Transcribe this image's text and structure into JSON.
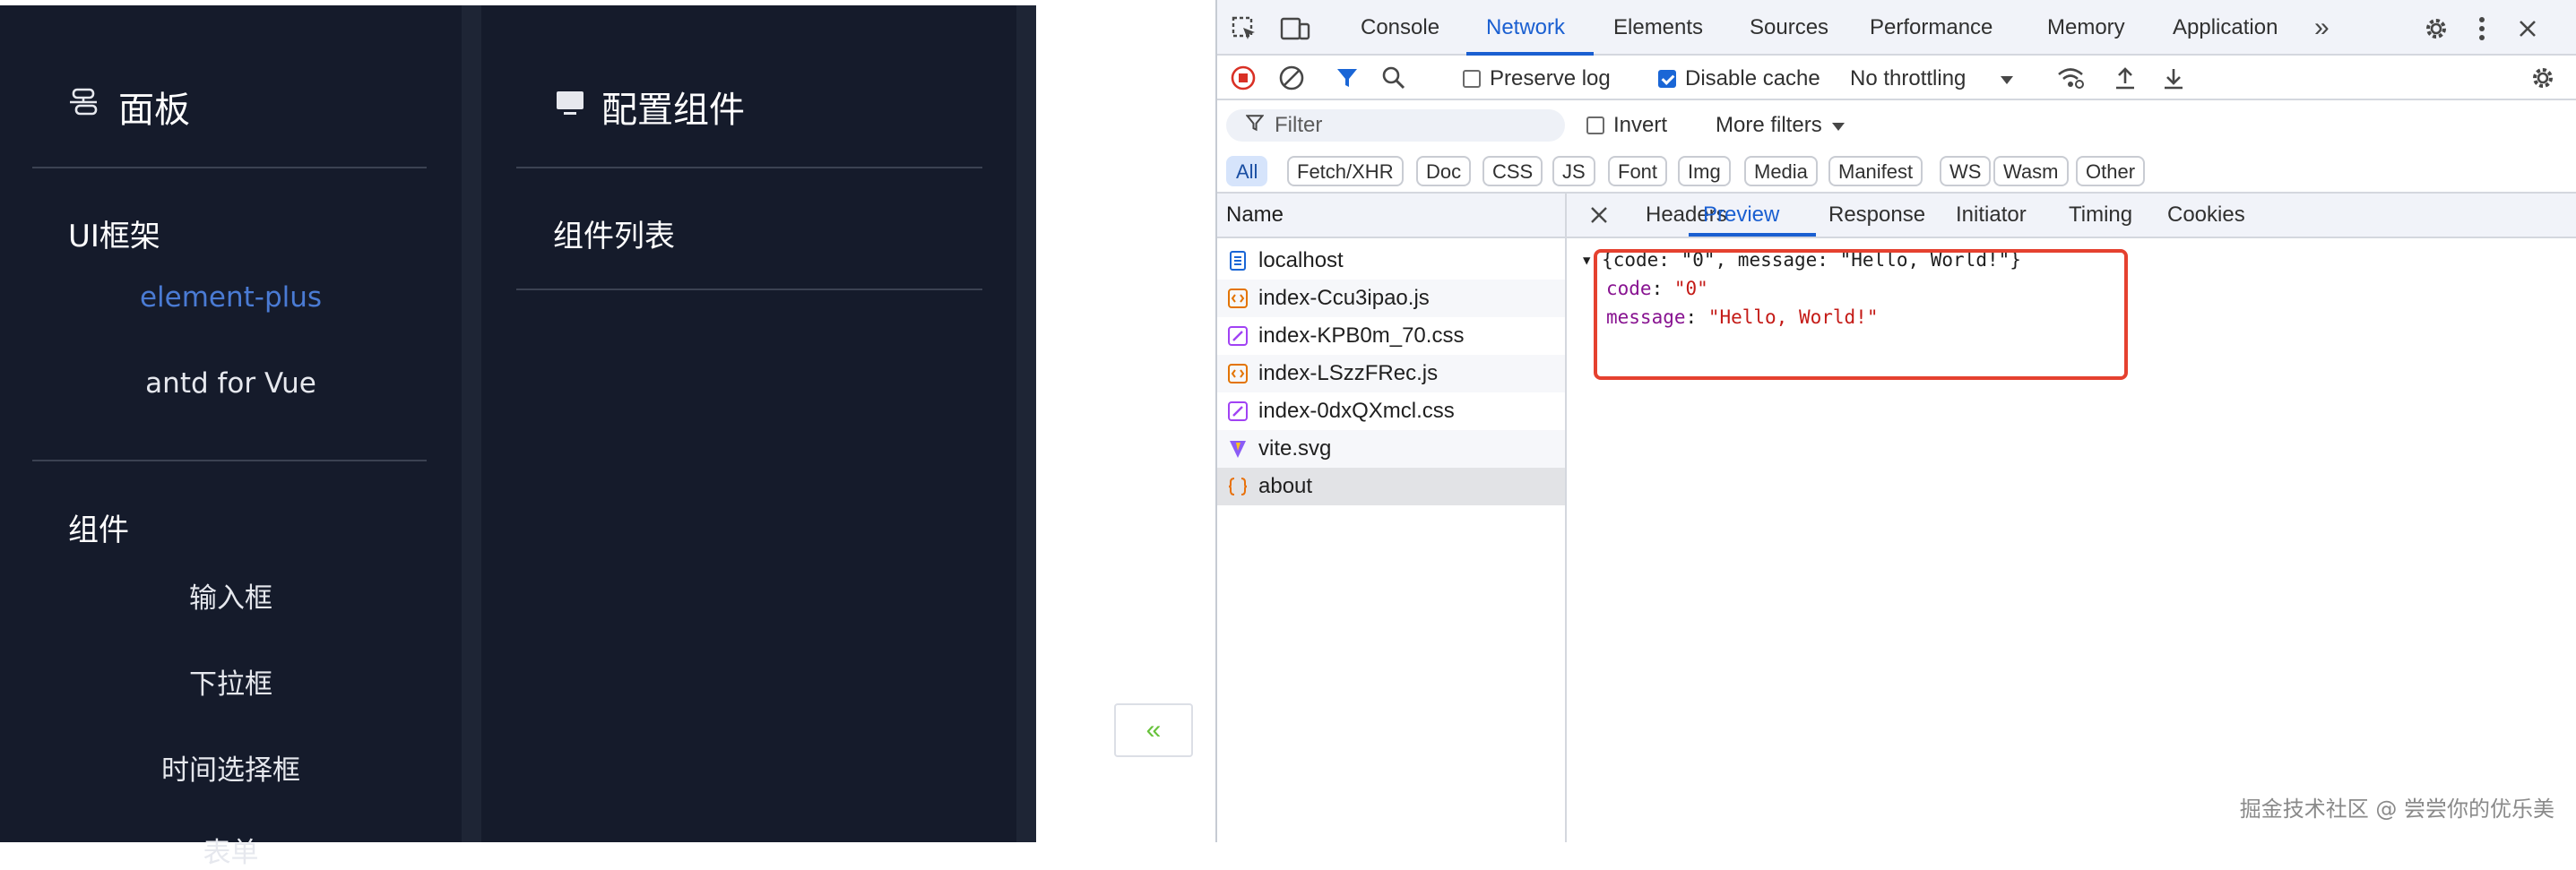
{
  "app": {
    "panel_title": "面板",
    "config_title": "配置组件",
    "framework_group": "UI框架",
    "framework_items": [
      "element-plus",
      "antd for Vue"
    ],
    "component_group": "组件",
    "component_items": [
      "输入框",
      "下拉框",
      "时间选择框",
      "表单"
    ],
    "component_list_title": "组件列表",
    "collapse_glyph": "«",
    "accent_color": "#4a7bd4"
  },
  "devtools": {
    "tabs": [
      "Console",
      "Network",
      "Elements",
      "Sources",
      "Performance",
      "Memory",
      "Application"
    ],
    "active_tab": "Network",
    "more_tabs_glyph": "»",
    "preserve_log_label": "Preserve log",
    "disable_cache_label": "Disable cache",
    "throttling_value": "No throttling",
    "filter_placeholder": "Filter",
    "invert_label": "Invert",
    "more_filters_label": "More filters",
    "type_filters": [
      "All",
      "Fetch/XHR",
      "Doc",
      "CSS",
      "JS",
      "Font",
      "Img",
      "Media",
      "Manifest",
      "WS",
      "Wasm",
      "Other"
    ],
    "list_header": "Name",
    "requests": [
      {
        "name": "localhost",
        "icon": "document-icon"
      },
      {
        "name": "index-Ccu3ipao.js",
        "icon": "script-icon"
      },
      {
        "name": "index-KPB0m_70.css",
        "icon": "stylesheet-icon"
      },
      {
        "name": "index-LSzzFRec.js",
        "icon": "script-icon"
      },
      {
        "name": "index-0dxQXmcl.css",
        "icon": "stylesheet-icon"
      },
      {
        "name": "vite.svg",
        "icon": "vite-logo-icon"
      },
      {
        "name": "about",
        "icon": "fetch-icon"
      }
    ],
    "selected_request": "about",
    "detail_tabs": [
      "Headers",
      "Preview",
      "Response",
      "Initiator",
      "Timing",
      "Cookies"
    ],
    "active_detail_tab": "Preview",
    "preview": {
      "summary": "{code: \"0\", message: \"Hello, World!\"}",
      "fields": [
        {
          "key": "code",
          "value": "\"0\""
        },
        {
          "key": "message",
          "value": "\"Hello, World!\""
        }
      ]
    },
    "highlight_color": "#e5412f"
  },
  "watermark": "掘金技术社区 @ 尝尝你的优乐美"
}
